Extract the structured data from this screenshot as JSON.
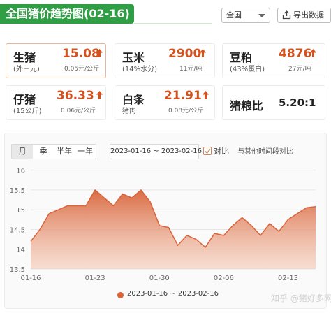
{
  "header": {
    "title": "全国猪价趋势图(02-16)"
  },
  "toolbar": {
    "region": "全国",
    "export_label": "导出数据"
  },
  "cards": [
    {
      "name": "生猪",
      "sub": "(外三元)",
      "value": "15.08",
      "change": "0.05元/公斤",
      "trend": "up",
      "active": true
    },
    {
      "name": "玉米",
      "sub": "(14%水分)",
      "value": "2900",
      "change": "11元/吨",
      "trend": "up",
      "active": false
    },
    {
      "name": "豆粕",
      "sub": "(43%蛋白)",
      "value": "4876",
      "change": "27元/吨",
      "trend": "up",
      "active": false
    },
    {
      "name": "仔猪",
      "sub": "(15公斤)",
      "value": "36.33",
      "change": "0.06元/公斤",
      "trend": "up",
      "active": false
    },
    {
      "name": "白条",
      "sub": "猪肉",
      "value": "21.91",
      "change": "0.08元/公斤",
      "trend": "up",
      "active": false
    },
    {
      "name": "猪粮比",
      "sub": "",
      "value": "5.20:1",
      "change": "",
      "trend": "none",
      "active": false
    }
  ],
  "chart_controls": {
    "periods": [
      "月",
      "季",
      "半年",
      "一年"
    ],
    "selected_period": "月",
    "date_range": "2023-01-16 ~ 2023-02-16",
    "compare_label": "对比",
    "compare_checked": true,
    "compare_other": "与其他时间段对比"
  },
  "chart_data": {
    "type": "area",
    "x": [
      "01-16",
      "01-17",
      "01-18",
      "01-19",
      "01-20",
      "01-21",
      "01-22",
      "01-23",
      "01-24",
      "01-25",
      "01-26",
      "01-27",
      "01-28",
      "01-29",
      "01-30",
      "01-31",
      "02-01",
      "02-02",
      "02-03",
      "02-04",
      "02-05",
      "02-06",
      "02-07",
      "02-08",
      "02-09",
      "02-10",
      "02-11",
      "02-12",
      "02-13",
      "02-14",
      "02-15",
      "02-16"
    ],
    "series": [
      {
        "name": "2023-01-16 ~ 2023-02-16",
        "values": [
          14.2,
          14.5,
          14.9,
          15.0,
          15.1,
          15.1,
          15.1,
          15.5,
          15.3,
          15.1,
          15.4,
          15.3,
          15.5,
          15.2,
          14.6,
          14.55,
          14.1,
          14.35,
          14.25,
          14.05,
          14.4,
          14.35,
          14.6,
          14.8,
          14.6,
          14.35,
          14.65,
          14.45,
          14.75,
          14.9,
          15.05,
          15.08
        ],
        "color": "#d8643a"
      }
    ],
    "xticks": [
      "01-16",
      "01-23",
      "01-30",
      "02-06",
      "02-13"
    ],
    "yticks": [
      13.5,
      14,
      14.5,
      15,
      15.5,
      16
    ],
    "ylim": [
      13.5,
      16.1
    ],
    "grid": true,
    "legend_position": "bottom"
  },
  "legend": {
    "label": "2023-01-16 ~ 2023-02-16"
  },
  "watermark": {
    "text": "知乎 @猪好多网"
  }
}
